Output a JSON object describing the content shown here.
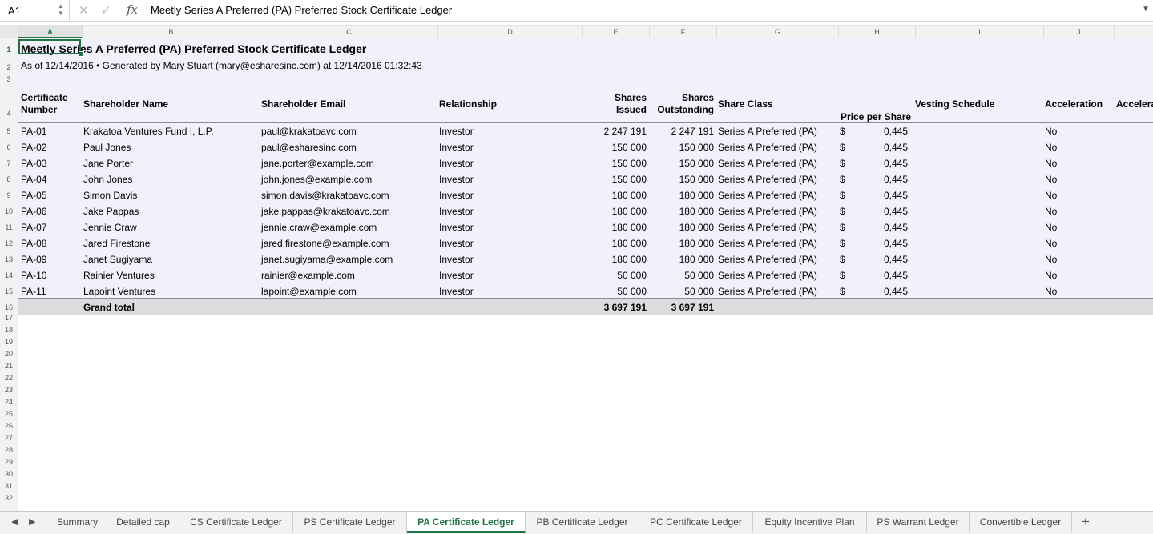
{
  "name_box": "A1",
  "formula": "Meetly Series A Preferred (PA) Preferred Stock Certificate Ledger",
  "columns": [
    "A",
    "B",
    "C",
    "D",
    "E",
    "F",
    "G",
    "H",
    "I",
    "J"
  ],
  "rows": [
    "1",
    "2",
    "3",
    "4",
    "5",
    "6",
    "7",
    "8",
    "9",
    "10",
    "11",
    "12",
    "13",
    "14",
    "15",
    "16",
    "17",
    "18",
    "19",
    "20",
    "21",
    "22",
    "23",
    "24",
    "25",
    "26",
    "27",
    "28",
    "29",
    "30",
    "31",
    "32"
  ],
  "title": "Meetly Series A Preferred (PA) Preferred Stock Certificate Ledger",
  "subtitle": "As of 12/14/2016 • Generated by Mary Stuart (mary@esharesinc.com) at 12/14/2016 01:32:43",
  "headers": {
    "cert_line1": "Certificate",
    "cert_line2": "Number",
    "name": "Shareholder Name",
    "email": "Shareholder Email",
    "relationship": "Relationship",
    "issued_line1": "Shares",
    "issued_line2": "Issued",
    "outstanding_line1": "Shares",
    "outstanding_line2": "Outstanding",
    "share_class": "Share Class",
    "price": "Price per Share",
    "vesting": "Vesting Schedule",
    "acceleration": "Acceleration",
    "acceleration2": "Accelera"
  },
  "ledger": [
    {
      "cert": "PA-01",
      "name": "Krakatoa Ventures Fund I, L.P.",
      "email": "paul@krakatoavc.com",
      "rel": "Investor",
      "issued": "2 247 191",
      "outstanding": "2 247 191",
      "class": "Series A Preferred (PA)",
      "cur": "$",
      "price": "0,445",
      "accel": "No"
    },
    {
      "cert": "PA-02",
      "name": "Paul Jones",
      "email": "paul@esharesinc.com",
      "rel": "Investor",
      "issued": "150 000",
      "outstanding": "150 000",
      "class": "Series A Preferred (PA)",
      "cur": "$",
      "price": "0,445",
      "accel": "No"
    },
    {
      "cert": "PA-03",
      "name": "Jane Porter",
      "email": "jane.porter@example.com",
      "rel": "Investor",
      "issued": "150 000",
      "outstanding": "150 000",
      "class": "Series A Preferred (PA)",
      "cur": "$",
      "price": "0,445",
      "accel": "No"
    },
    {
      "cert": "PA-04",
      "name": "John Jones",
      "email": "john.jones@example.com",
      "rel": "Investor",
      "issued": "150 000",
      "outstanding": "150 000",
      "class": "Series A Preferred (PA)",
      "cur": "$",
      "price": "0,445",
      "accel": "No"
    },
    {
      "cert": "PA-05",
      "name": "Simon Davis",
      "email": "simon.davis@krakatoavc.com",
      "rel": "Investor",
      "issued": "180 000",
      "outstanding": "180 000",
      "class": "Series A Preferred (PA)",
      "cur": "$",
      "price": "0,445",
      "accel": "No"
    },
    {
      "cert": "PA-06",
      "name": "Jake Pappas",
      "email": "jake.pappas@krakatoavc.com",
      "rel": "Investor",
      "issued": "180 000",
      "outstanding": "180 000",
      "class": "Series A Preferred (PA)",
      "cur": "$",
      "price": "0,445",
      "accel": "No"
    },
    {
      "cert": "PA-07",
      "name": "Jennie Craw",
      "email": "jennie.craw@example.com",
      "rel": "Investor",
      "issued": "180 000",
      "outstanding": "180 000",
      "class": "Series A Preferred (PA)",
      "cur": "$",
      "price": "0,445",
      "accel": "No"
    },
    {
      "cert": "PA-08",
      "name": "Jared Firestone",
      "email": "jared.firestone@example.com",
      "rel": "Investor",
      "issued": "180 000",
      "outstanding": "180 000",
      "class": "Series A Preferred (PA)",
      "cur": "$",
      "price": "0,445",
      "accel": "No"
    },
    {
      "cert": "PA-09",
      "name": "Janet Sugiyama",
      "email": "janet.sugiyama@example.com",
      "rel": "Investor",
      "issued": "180 000",
      "outstanding": "180 000",
      "class": "Series A Preferred (PA)",
      "cur": "$",
      "price": "0,445",
      "accel": "No"
    },
    {
      "cert": "PA-10",
      "name": "Rainier Ventures",
      "email": "rainier@example.com",
      "rel": "Investor",
      "issued": "50 000",
      "outstanding": "50 000",
      "class": "Series A Preferred (PA)",
      "cur": "$",
      "price": "0,445",
      "accel": "No"
    },
    {
      "cert": "PA-11",
      "name": "Lapoint Ventures",
      "email": "lapoint@example.com",
      "rel": "Investor",
      "issued": "50 000",
      "outstanding": "50 000",
      "class": "Series A Preferred (PA)",
      "cur": "$",
      "price": "0,445",
      "accel": "No"
    }
  ],
  "total": {
    "label": "Grand total",
    "issued": "3 697 191",
    "outstanding": "3 697 191"
  },
  "tabs": [
    "Summary",
    "Detailed cap",
    "CS Certificate Ledger",
    "PS Certificate Ledger",
    "PA Certificate Ledger",
    "PB Certificate Ledger",
    "PC Certificate Ledger",
    "Equity Incentive Plan",
    "PS Warrant Ledger",
    "Convertible Ledger"
  ],
  "active_tab": "PA Certificate Ledger",
  "accent_color": "#217346"
}
